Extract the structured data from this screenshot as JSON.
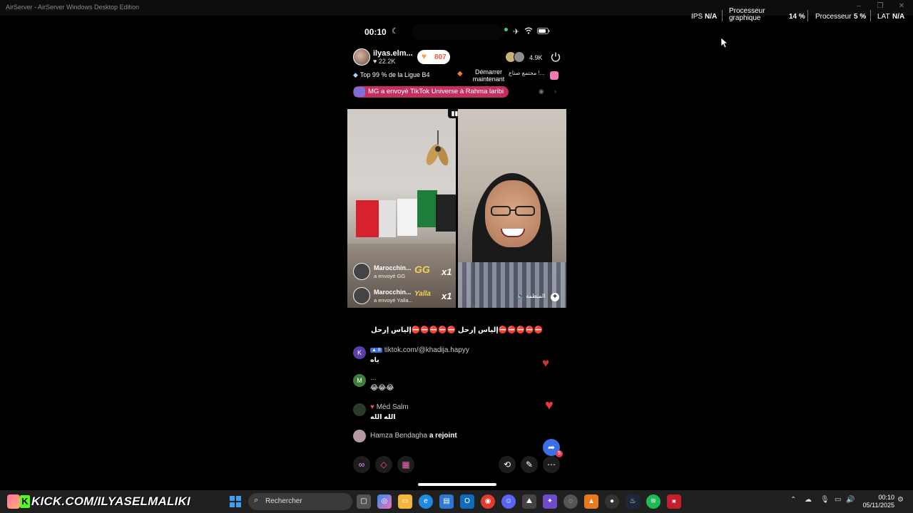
{
  "window": {
    "title": "AirServer - AirServer Windows Desktop Edition"
  },
  "stats": {
    "fps_label": "IPS",
    "fps_value": "N/A",
    "gpu_label_line1": "Processeur",
    "gpu_label_line2": "graphique",
    "gpu_value": "14 %",
    "cpu_label": "Processeur",
    "cpu_value": "5 %",
    "lat_label": "LAT",
    "lat_value": "N/A"
  },
  "phone": {
    "status_time": "00:10",
    "host": {
      "name": "ilyas.elm...",
      "followers": "22.2K",
      "likes": "807"
    },
    "viewer_count": "4.9K",
    "rank": "Top 99 % de la Ligue B4",
    "go_live": "Démarrer maintenant",
    "arabic_pill": "مجتمع صناع !...",
    "gift_banner": "MG a envoyé TikTok Universe à Rahma laribi",
    "gifts": [
      {
        "name": "Marocchin...",
        "sub": "a envoyé  GG",
        "gift": "GG",
        "count": "x1"
      },
      {
        "name": "Marocchin...",
        "sub": "a envoyé  Yalla...",
        "gift": "Yalla",
        "count": "x1"
      }
    ],
    "guest_label": "المنظمة",
    "chat_top": "⛔⛔⛔⛔⛔إلياس إرحل ⛔⛔⛔⛔⛔إلياس إرحل",
    "chat": [
      {
        "initial": "K",
        "badge": "8",
        "name": "tiktok.com/@khadija.hapyy",
        "text": "ياه",
        "avatar_color": "#5b3ea8"
      },
      {
        "initial": "M",
        "badge": "",
        "name": "...",
        "text": "😂😂😂",
        "avatar_color": "#3f7d3b"
      },
      {
        "initial": "",
        "badge": "",
        "name": "Méd Salm",
        "text": "الله الله",
        "avatar_color": "#2b3b2b"
      }
    ],
    "joined_name": "Hamza Bendagha",
    "joined_text": "a rejoint",
    "share_count": "5"
  },
  "taskbar": {
    "kick_text": "KICK.COM/ILYASELMALIKI",
    "search_placeholder": "Rechercher",
    "clock_time": "00:10",
    "clock_date": "05/11/2025"
  }
}
